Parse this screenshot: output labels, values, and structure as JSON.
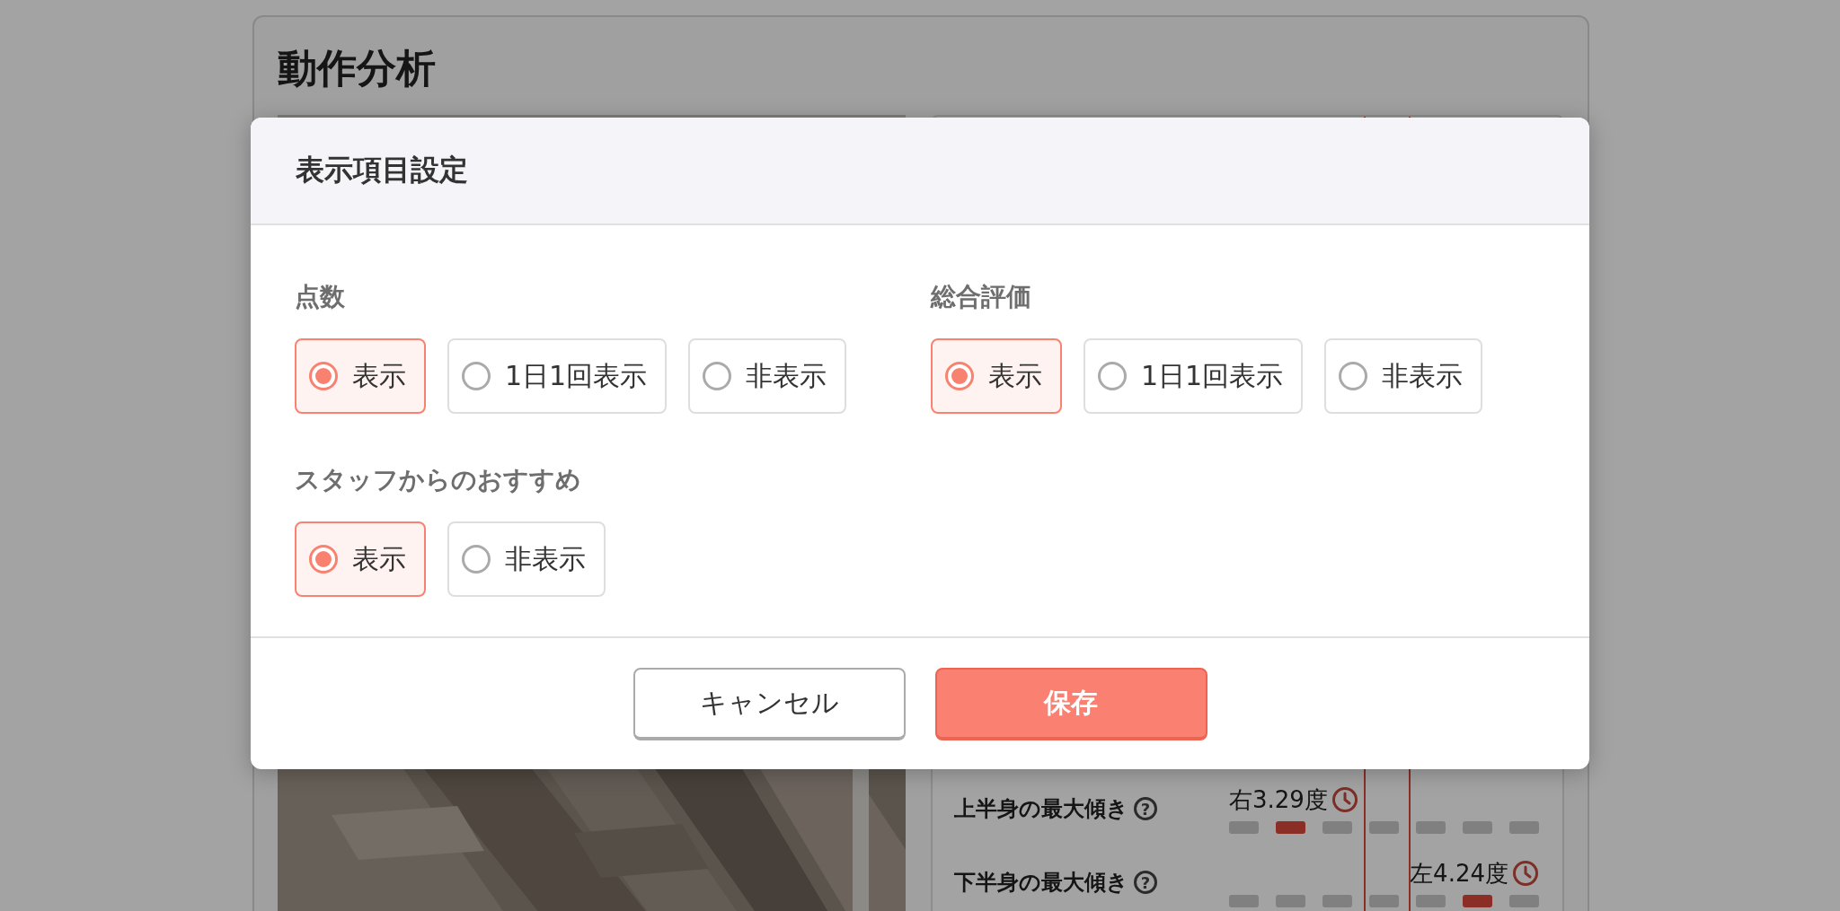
{
  "page": {
    "title": "動作分析"
  },
  "metrics": [
    {
      "label": "上半身の最大傾き",
      "help_icon": "?",
      "value": "右3.29度",
      "segments": [
        {
          "highlighted": false
        },
        {
          "highlighted": true
        },
        {
          "highlighted": false
        },
        {
          "highlighted": false
        },
        {
          "highlighted": false
        },
        {
          "highlighted": false
        },
        {
          "highlighted": false
        }
      ]
    },
    {
      "label": "下半身の最大傾き",
      "help_icon": "?",
      "value": "左4.24度",
      "segments": [
        {
          "highlighted": false
        },
        {
          "highlighted": false
        },
        {
          "highlighted": false
        },
        {
          "highlighted": false
        },
        {
          "highlighted": false
        },
        {
          "highlighted": true
        },
        {
          "highlighted": false
        }
      ]
    }
  ],
  "dialog": {
    "title": "表示項目設定",
    "groups": [
      {
        "label": "点数",
        "options": [
          {
            "label": "表示",
            "selected": true
          },
          {
            "label": "1日1回表示",
            "selected": false
          },
          {
            "label": "非表示",
            "selected": false
          }
        ]
      },
      {
        "label": "総合評価",
        "options": [
          {
            "label": "表示",
            "selected": true
          },
          {
            "label": "1日1回表示",
            "selected": false
          },
          {
            "label": "非表示",
            "selected": false
          }
        ]
      },
      {
        "label": "スタッフからのおすすめ",
        "options": [
          {
            "label": "表示",
            "selected": true
          },
          {
            "label": "非表示",
            "selected": false
          }
        ]
      }
    ],
    "buttons": [
      {
        "label": "キャンセル",
        "kind": "secondary"
      },
      {
        "label": "保存",
        "kind": "primary"
      }
    ]
  }
}
